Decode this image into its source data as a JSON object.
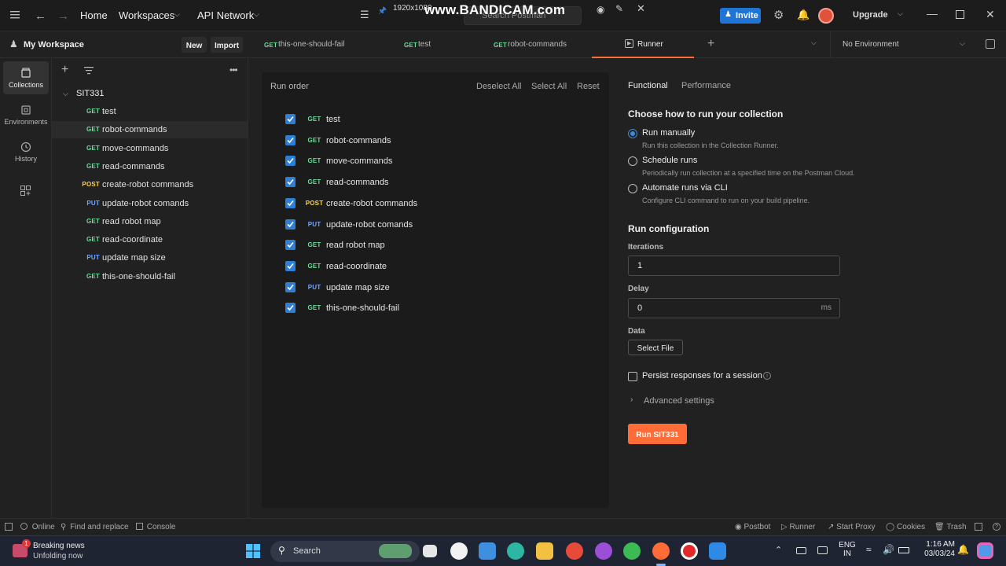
{
  "topbar": {
    "home": "Home",
    "workspaces": "Workspaces",
    "api_network": "API Network",
    "resolution": "1920x1080",
    "watermark": "www.BANDICAM.com",
    "search_placeholder": "Search Postman",
    "invite": "Invite",
    "upgrade": "Upgrade"
  },
  "workspace": {
    "name": "My Workspace",
    "new_label": "New",
    "import_label": "Import"
  },
  "tabs": [
    {
      "method": "GET",
      "label": "this-one-should-fail"
    },
    {
      "method": "GET",
      "label": "test"
    },
    {
      "method": "GET",
      "label": "robot-commands"
    },
    {
      "method": "",
      "label": "Runner"
    }
  ],
  "environment": "No Environment",
  "rail": [
    {
      "label": "Collections"
    },
    {
      "label": "Environments"
    },
    {
      "label": "History"
    }
  ],
  "collection": {
    "name": "SIT331",
    "requests": [
      {
        "method": "GET",
        "name": "test"
      },
      {
        "method": "GET",
        "name": "robot-commands"
      },
      {
        "method": "GET",
        "name": "move-commands"
      },
      {
        "method": "GET",
        "name": "read-commands"
      },
      {
        "method": "POST",
        "name": "create-robot commands"
      },
      {
        "method": "PUT",
        "name": "update-robot comands"
      },
      {
        "method": "GET",
        "name": "read robot map"
      },
      {
        "method": "GET",
        "name": "read-coordinate"
      },
      {
        "method": "PUT",
        "name": "update map size"
      },
      {
        "method": "GET",
        "name": "this-one-should-fail"
      }
    ]
  },
  "runner": {
    "run_order": "Run order",
    "deselect_all": "Deselect All",
    "select_all": "Select All",
    "reset": "Reset",
    "tab_functional": "Functional",
    "tab_performance": "Performance",
    "choose_heading": "Choose how to run your collection",
    "options": [
      {
        "title": "Run manually",
        "desc": "Run this collection in the Collection Runner.",
        "selected": true
      },
      {
        "title": "Schedule runs",
        "desc": "Periodically run collection at a specified time on the Postman Cloud.",
        "selected": false
      },
      {
        "title": "Automate runs via CLI",
        "desc": "Configure CLI command to run on your build pipeline.",
        "selected": false
      }
    ],
    "config_heading": "Run configuration",
    "iterations_label": "Iterations",
    "iterations_value": "1",
    "delay_label": "Delay",
    "delay_value": "0",
    "delay_unit": "ms",
    "data_label": "Data",
    "select_file": "Select File",
    "persist_label": "Persist responses for a session",
    "advanced": "Advanced settings",
    "run_button": "Run SIT331"
  },
  "statusbar": {
    "online": "Online",
    "find_replace": "Find and replace",
    "console": "Console",
    "postbot": "Postbot",
    "runner": "Runner",
    "start_proxy": "Start Proxy",
    "cookies": "Cookies",
    "trash": "Trash"
  },
  "taskbar": {
    "news_title": "Breaking news",
    "news_sub": "Unfolding now",
    "news_badge": "1",
    "search": "Search",
    "lang1": "ENG",
    "lang2": "IN",
    "time": "1:16 AM",
    "date": "03/03/24"
  },
  "colors": {
    "accent_orange": "#ff6c37",
    "accent_blue": "#1f74d6",
    "get": "#6bdd9a",
    "post": "#ffd24a",
    "put": "#72a8ff"
  }
}
